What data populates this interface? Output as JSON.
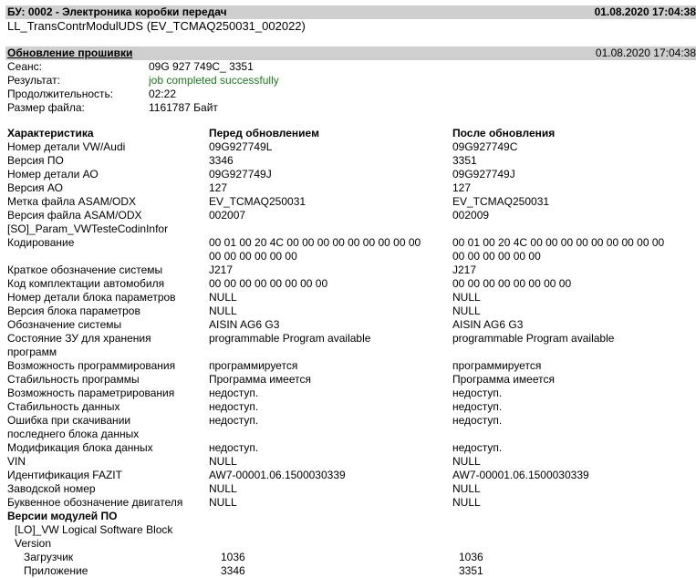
{
  "header": {
    "title": "БУ: 0002 - Электроника коробки передач",
    "datetime": "01.08.2020 17:04:38",
    "subtitle": "LL_TransContrModulUDS (EV_TCMAQ250031_002022)"
  },
  "update": {
    "title": "Обновление прошивки",
    "datetime": "01.08.2020 17:04:38",
    "rows": [
      {
        "label": "Сеанс:",
        "value": "09G 927 749C_ 3351"
      },
      {
        "label": "Результат:",
        "value": "job completed successfully"
      },
      {
        "label": "Продолжительность:",
        "value": "02:22"
      },
      {
        "label": "Размер файла:",
        "value": "1161787 Байт"
      }
    ]
  },
  "table": {
    "headers": [
      "Характеристика",
      "Перед обновлением",
      "После обновления"
    ],
    "rows": [
      {
        "c": "Номер детали VW/Audi",
        "b": "09G927749L",
        "a": "09G927749C"
      },
      {
        "c": "Версия ПО",
        "b": "3346",
        "a": "3351"
      },
      {
        "c": "Номер детали АО",
        "b": "09G927749J",
        "a": "09G927749J"
      },
      {
        "c": "Версия АО",
        "b": "127",
        "a": "127"
      },
      {
        "c": "Метка файла ASAM/ODX",
        "b": "EV_TCMAQ250031",
        "a": "EV_TCMAQ250031"
      },
      {
        "c": "Версия файла ASAM/ODX",
        "b": "002007",
        "a": "002009"
      },
      {
        "c": "[SO]_Param_VWTesteCodinInfor",
        "b": "",
        "a": ""
      },
      {
        "c": "Кодирование",
        "b": "00 01 00 20 4C 00 00 00 00 00 00 00 00 00",
        "b2": "00 00 00 00 00 00",
        "a": "00 01 00 20 4C 00 00 00 00 00 00 00 00 00",
        "a2": "00 00 00 00 00 00"
      },
      {
        "c": "Краткое обозначение системы",
        "b": "J217",
        "a": "J217"
      },
      {
        "c": "Код комплектации автомобиля",
        "b": "00 00 00 00 00 00 00 00",
        "a": "00 00 00 00 00 00 00 00"
      },
      {
        "c": "Номер детали блока параметров",
        "b": "NULL",
        "a": "NULL"
      },
      {
        "c": "Версия блока параметров",
        "b": "NULL",
        "a": "NULL"
      },
      {
        "c": "Обозначение системы",
        "b": "AISIN AG6 G3",
        "a": "AISIN AG6 G3"
      },
      {
        "c": "Состояние ЗУ для хранения",
        "c2": "программ",
        "b": "programmable Program available",
        "a": "programmable Program available"
      },
      {
        "c": "Возможность программирования",
        "b": "программируется",
        "a": "программируется"
      },
      {
        "c": "Стабильность программы",
        "b": "Программа имеется",
        "a": "Программа имеется"
      },
      {
        "c": "Возможность параметрирования",
        "b": "недоступ.",
        "a": "недоступ."
      },
      {
        "c": "Стабильность данных",
        "b": "недоступ.",
        "a": "недоступ."
      },
      {
        "c": "Ошибка при скачивании",
        "c2": "последнего блока данных",
        "b": "недоступ.",
        "a": "недоступ."
      },
      {
        "c": "Модификация блока данных",
        "b": "недоступ.",
        "a": "недоступ."
      },
      {
        "c": "VIN",
        "b": "NULL",
        "a": "NULL"
      },
      {
        "c": "Идентификация FAZIT",
        "b": "AW7-00001.06.1500030339",
        "a": "AW7-00001.06.1500030339"
      },
      {
        "c": "Заводской номер",
        "b": "NULL",
        "a": "NULL"
      },
      {
        "c": "Буквенное обозначение двигателя",
        "b": "NULL",
        "a": "NULL"
      }
    ]
  },
  "modules": {
    "title": "Версии модулей ПО",
    "block": "[LO]_VW Logical Software Block",
    "version_label": "Version",
    "rows": [
      {
        "label": "Загрузчик",
        "before": "1036",
        "after": "1036"
      },
      {
        "label": "Приложение",
        "before": "3346",
        "after": "3351"
      }
    ]
  }
}
